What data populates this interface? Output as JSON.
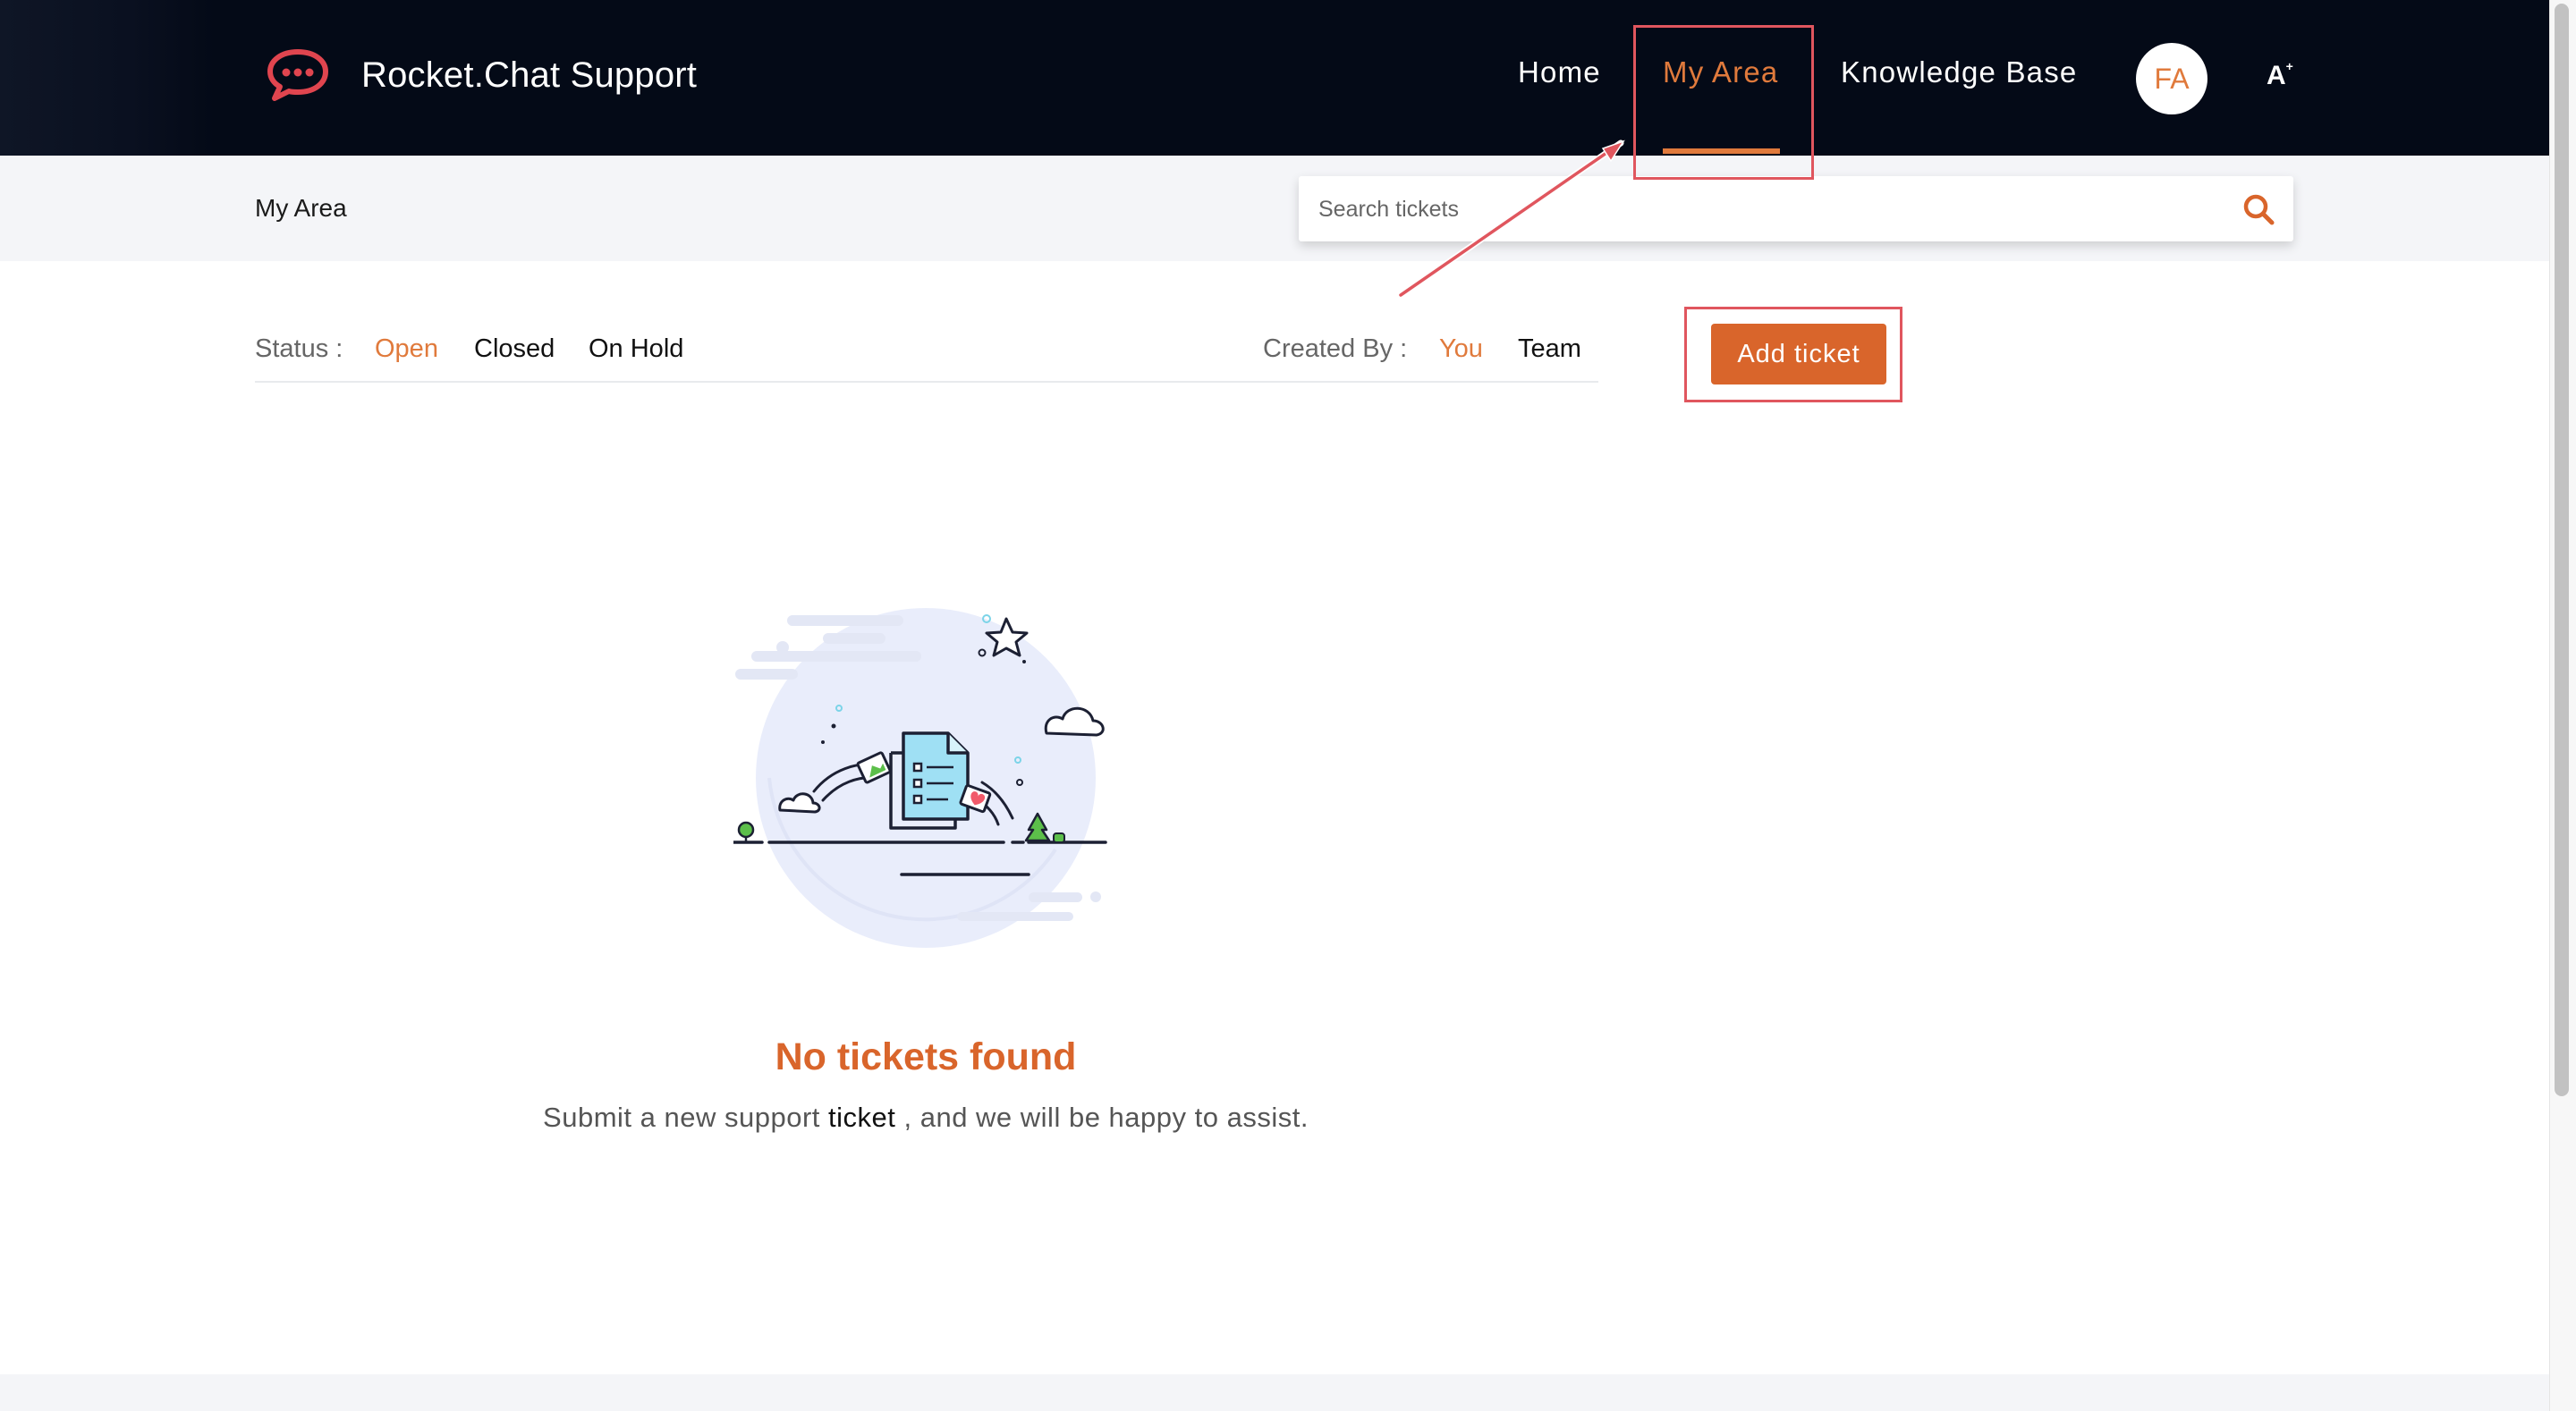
{
  "header": {
    "brand_name": "Rocket.Chat Support",
    "logo_icon": "rocket-chat-logo",
    "nav": [
      {
        "label": "Home",
        "active": false
      },
      {
        "label": "My Area",
        "active": true
      },
      {
        "label": "Knowledge Base",
        "active": false
      }
    ],
    "avatar_initials": "FA",
    "font_size_label": "A"
  },
  "subheader": {
    "page_title": "My Area",
    "search_placeholder": "Search tickets",
    "search_icon": "search-icon"
  },
  "filters": {
    "status_label": "Status :",
    "status_options": [
      {
        "label": "Open",
        "active": true
      },
      {
        "label": "Closed",
        "active": false
      },
      {
        "label": "On Hold",
        "active": false
      }
    ],
    "created_by_label": "Created By :",
    "created_by_options": [
      {
        "label": "You",
        "active": true
      },
      {
        "label": "Team",
        "active": false
      }
    ]
  },
  "actions": {
    "add_ticket_label": "Add ticket"
  },
  "empty_state": {
    "title": "No tickets found",
    "message_before": "Submit a new support",
    "message_link": "ticket",
    "message_after": ", and we will be happy to assist."
  },
  "colors": {
    "header_bg": "#040a17",
    "accent": "#e07a3c",
    "button": "#d9652b",
    "annotation": "#e0565e"
  }
}
